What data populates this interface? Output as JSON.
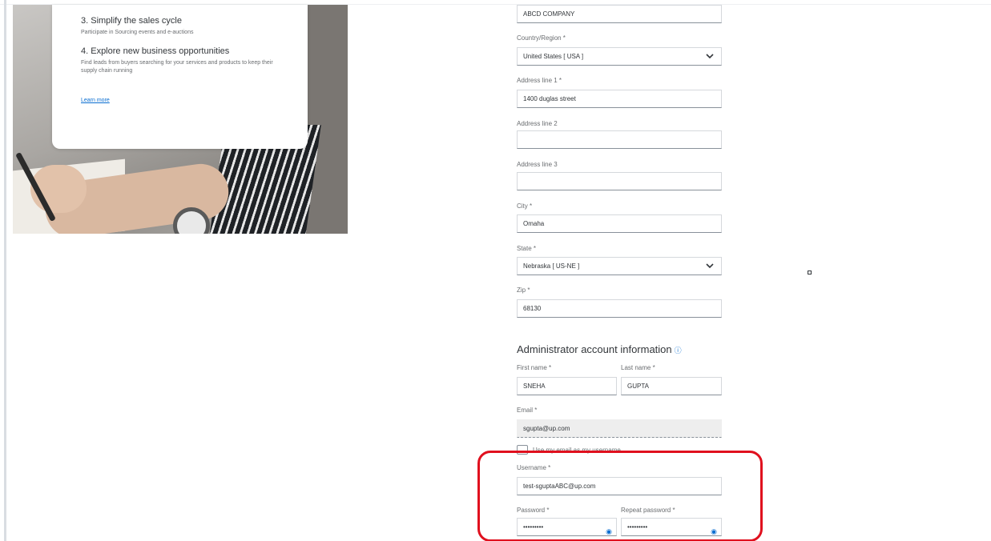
{
  "promo": {
    "item3_title": "3. Simplify the sales cycle",
    "item3_text": "Participate in Sourcing events and e-auctions",
    "item4_title": "4. Explore new business opportunities",
    "item4_text": "Find leads from buyers searching for your services and products to keep their supply chain running",
    "learn_more": "Learn more"
  },
  "company": {
    "name_value": "ABCD COMPANY",
    "country_label": "Country/Region *",
    "country_value": "United States [ USA ]",
    "address1_label": "Address line 1 *",
    "address1_value": "1400 duglas street",
    "address2_label": "Address line 2",
    "address2_value": "",
    "address3_label": "Address line 3",
    "address3_value": "",
    "city_label": "City *",
    "city_value": "Omaha",
    "state_label": "State *",
    "state_value": "Nebraska [ US-NE ]",
    "zip_label": "Zip *",
    "zip_value": "68130"
  },
  "admin": {
    "section_title": "Administrator account information",
    "first_name_label": "First name *",
    "first_name_value": "SNEHA",
    "last_name_label": "Last name *",
    "last_name_value": "GUPTA",
    "email_label": "Email *",
    "email_value": "sgupta@up.com",
    "use_email_label": "Use my email as my username",
    "username_label": "Username *",
    "username_value": "test-sguptaABC@up.com",
    "password_label": "Password *",
    "password_value": "•••••••••",
    "repeat_password_label": "Repeat password *",
    "repeat_password_value": "•••••••••"
  },
  "icons": {
    "dropdown": "chevron-down-icon",
    "help": "help-circle-icon",
    "reveal": "eye-icon"
  },
  "colors": {
    "accent": "#0a6ed1",
    "highlight": "#e0101e"
  }
}
